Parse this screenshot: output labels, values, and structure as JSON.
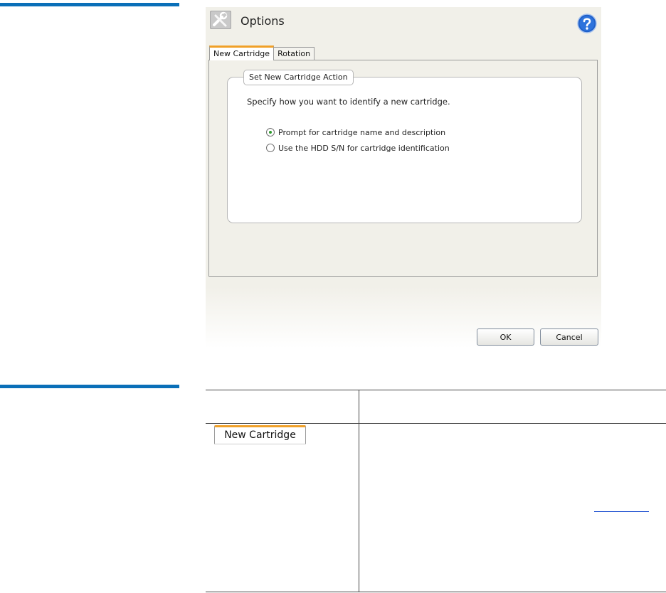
{
  "dialog": {
    "title": "Options",
    "tabs": [
      {
        "label": "New Cartridge",
        "active": true
      },
      {
        "label": "Rotation",
        "active": false
      }
    ],
    "group": {
      "legend": "Set New Cartridge Action",
      "instruction": "Specify how you want to identify a new cartridge.",
      "options": [
        {
          "label": "Prompt for cartridge name and description",
          "checked": true
        },
        {
          "label": "Use the HDD S/N for cartridge identification",
          "checked": false
        }
      ]
    },
    "buttons": {
      "ok": "OK",
      "cancel": "Cancel"
    }
  },
  "table": {
    "row1_tab_label": "New Cartridge"
  },
  "colors": {
    "accent_rule": "#0a6fb8",
    "tab_accent": "#f0a028",
    "radio_selected": "#2c9a2c",
    "link": "#1d4fd0"
  },
  "icons": [
    "tools-icon",
    "help-icon",
    "radio-checked-icon",
    "radio-unchecked-icon"
  ]
}
